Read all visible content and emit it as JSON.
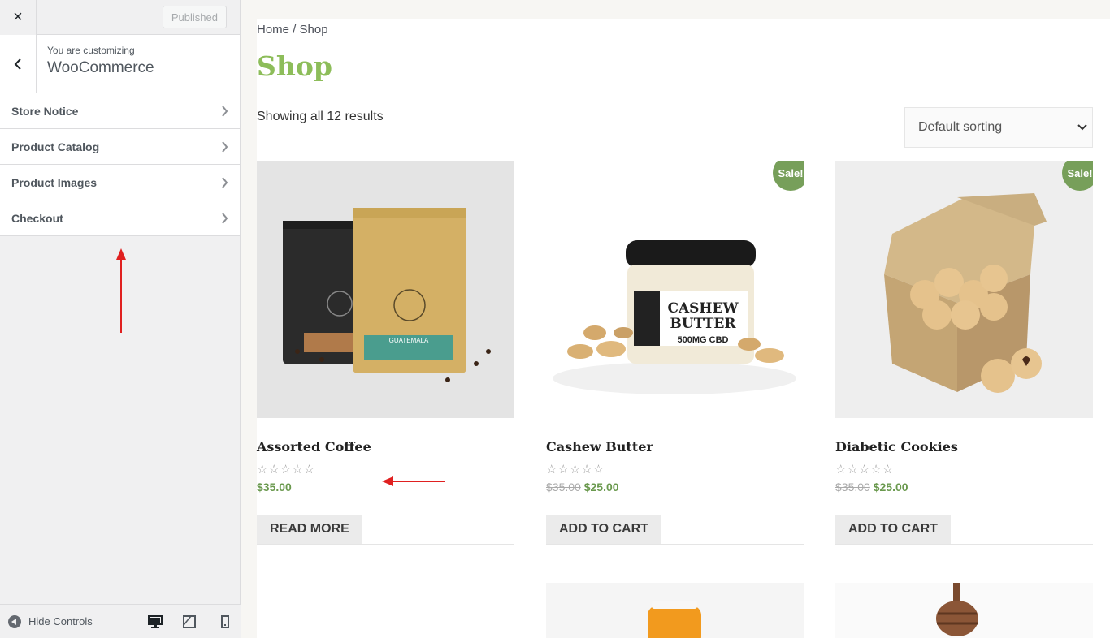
{
  "customizer": {
    "close_label": "×",
    "publish_label": "Published",
    "crumb_small": "You are customizing",
    "crumb_title": "WooCommerce",
    "items": [
      {
        "label": "Store Notice"
      },
      {
        "label": "Product Catalog"
      },
      {
        "label": "Product Images"
      },
      {
        "label": "Checkout"
      }
    ],
    "hide_controls": "Hide Controls"
  },
  "shop": {
    "breadcrumb": "Home / Shop",
    "title": "Shop",
    "results": "Showing all 12 results",
    "sorting": "Default sorting",
    "products": [
      {
        "name": "Assorted Coffee",
        "stars": "☆☆☆☆☆",
        "old_price": "",
        "price": "$35.00",
        "button": "READ MORE",
        "sale": ""
      },
      {
        "name": "Cashew Butter",
        "stars": "☆☆☆☆☆",
        "old_price": "$35.00",
        "price": "$25.00",
        "button": "ADD TO CART",
        "sale": "Sale!"
      },
      {
        "name": "Diabetic Cookies",
        "stars": "☆☆☆☆☆",
        "old_price": "$35.00",
        "price": "$25.00",
        "button": "ADD TO CART",
        "sale": "Sale!"
      }
    ],
    "jar_label_top": "CASHEW",
    "jar_label_mid": "BUTTER",
    "jar_label_bottom": "500MG CBD",
    "bag_label": "GUATEMALA"
  },
  "colors": {
    "accent": "#8dbd5a",
    "sale": "#779f5a",
    "arrow": "#e02020"
  }
}
